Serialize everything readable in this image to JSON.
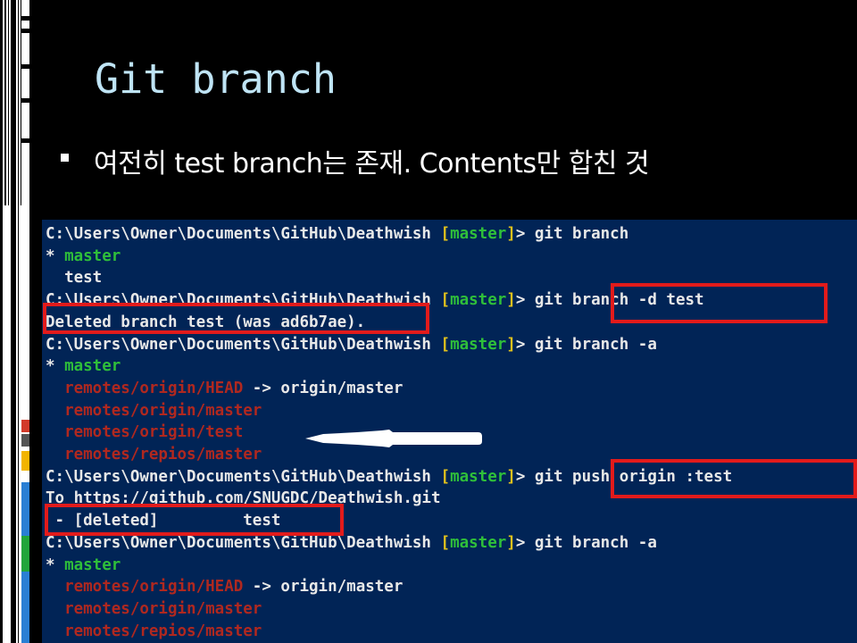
{
  "slide": {
    "title": "Git branch",
    "bullet": "여전히 test branch는 존재. Contents만 합친 것"
  },
  "terminal": {
    "lines": [
      {
        "segments": [
          {
            "t": "C:\\Users\\Owner\\Documents\\GitHub\\Deathwish ",
            "c": "w"
          },
          {
            "t": "[",
            "c": "y"
          },
          {
            "t": "master",
            "c": "g"
          },
          {
            "t": "]",
            "c": "y"
          },
          {
            "t": "> git branch",
            "c": "w"
          }
        ]
      },
      {
        "segments": [
          {
            "t": "* ",
            "c": "w"
          },
          {
            "t": "master",
            "c": "g"
          }
        ]
      },
      {
        "segments": [
          {
            "t": "  test",
            "c": "w"
          }
        ]
      },
      {
        "segments": [
          {
            "t": "C:\\Users\\Owner\\Documents\\GitHub\\Deathwish ",
            "c": "w"
          },
          {
            "t": "[",
            "c": "y"
          },
          {
            "t": "master",
            "c": "g"
          },
          {
            "t": "]",
            "c": "y"
          },
          {
            "t": "> git branch -d test",
            "c": "w"
          }
        ]
      },
      {
        "segments": [
          {
            "t": "Deleted branch test (was ad6b7ae).",
            "c": "w"
          }
        ]
      },
      {
        "segments": [
          {
            "t": "C:\\Users\\Owner\\Documents\\GitHub\\Deathwish ",
            "c": "w"
          },
          {
            "t": "[",
            "c": "y"
          },
          {
            "t": "master",
            "c": "g"
          },
          {
            "t": "]",
            "c": "y"
          },
          {
            "t": "> git branch -a",
            "c": "w"
          }
        ]
      },
      {
        "segments": [
          {
            "t": "* ",
            "c": "w"
          },
          {
            "t": "master",
            "c": "g"
          }
        ]
      },
      {
        "segments": [
          {
            "t": "  ",
            "c": "w"
          },
          {
            "t": "remotes/origin/HEAD",
            "c": "r"
          },
          {
            "t": " -> origin/master",
            "c": "w"
          }
        ]
      },
      {
        "segments": [
          {
            "t": "  ",
            "c": "w"
          },
          {
            "t": "remotes/origin/master",
            "c": "r"
          }
        ]
      },
      {
        "segments": [
          {
            "t": "  ",
            "c": "w"
          },
          {
            "t": "remotes/origin/test",
            "c": "r"
          }
        ]
      },
      {
        "segments": [
          {
            "t": "  ",
            "c": "w"
          },
          {
            "t": "remotes/repios/master",
            "c": "r"
          }
        ]
      },
      {
        "segments": [
          {
            "t": "C:\\Users\\Owner\\Documents\\GitHub\\Deathwish ",
            "c": "w"
          },
          {
            "t": "[",
            "c": "y"
          },
          {
            "t": "master",
            "c": "g"
          },
          {
            "t": "]",
            "c": "y"
          },
          {
            "t": "> git push origin :test",
            "c": "w"
          }
        ]
      },
      {
        "segments": [
          {
            "t": "To https://github.com/SNUGDC/Deathwish.git",
            "c": "w"
          }
        ]
      },
      {
        "segments": [
          {
            "t": " - [deleted]         test",
            "c": "w"
          }
        ]
      },
      {
        "segments": [
          {
            "t": "C:\\Users\\Owner\\Documents\\GitHub\\Deathwish ",
            "c": "w"
          },
          {
            "t": "[",
            "c": "y"
          },
          {
            "t": "master",
            "c": "g"
          },
          {
            "t": "]",
            "c": "y"
          },
          {
            "t": "> git branch -a",
            "c": "w"
          }
        ]
      },
      {
        "segments": [
          {
            "t": "* ",
            "c": "w"
          },
          {
            "t": "master",
            "c": "g"
          }
        ]
      },
      {
        "segments": [
          {
            "t": "  ",
            "c": "w"
          },
          {
            "t": "remotes/origin/HEAD",
            "c": "r"
          },
          {
            "t": " -> origin/master",
            "c": "w"
          }
        ]
      },
      {
        "segments": [
          {
            "t": "  ",
            "c": "w"
          },
          {
            "t": "remotes/origin/master",
            "c": "r"
          }
        ]
      },
      {
        "segments": [
          {
            "t": "  ",
            "c": "w"
          },
          {
            "t": "remotes/repios/master",
            "c": "r"
          }
        ]
      }
    ]
  },
  "colors": {
    "slide_bg": "#000000",
    "title": "#bfe4f5",
    "console_bg": "#012456",
    "highlight_box": "#e21b1b",
    "branch_green": "#2fbf3a",
    "bracket_yellow": "#e2c21c",
    "remote_red": "#b0281f"
  },
  "icons": {
    "bullet": "square-bullet",
    "annotation": "arrow-pointer-icon"
  }
}
